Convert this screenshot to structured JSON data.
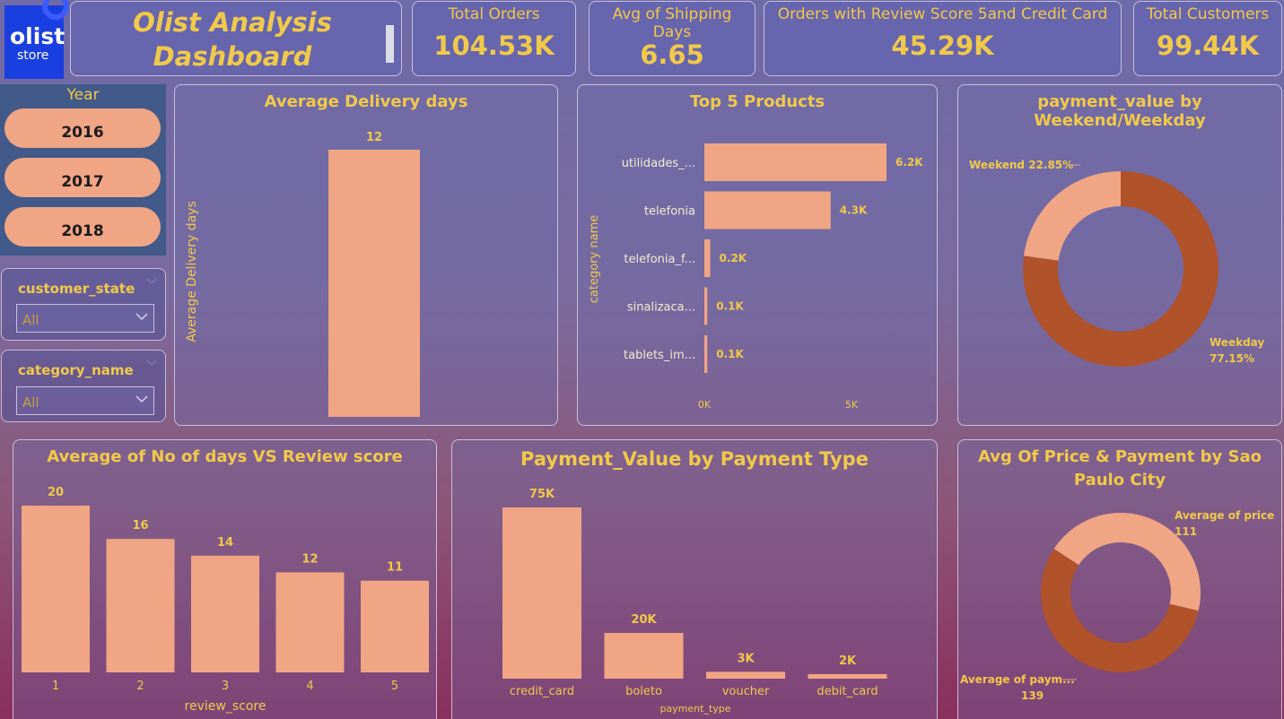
{
  "logo": {
    "line1": "olist",
    "line2": "store"
  },
  "dashboard_title": {
    "line1": "Olist Analysis",
    "line2": "Dashboard"
  },
  "kpis": [
    {
      "label": "Total Orders",
      "value": "104.53K"
    },
    {
      "label": "Avg of Shipping Days",
      "value": "6.65"
    },
    {
      "label": "Orders with Review Score 5and Credit Card",
      "value": "45.29K"
    },
    {
      "label": "Total Customers",
      "value": "99.44K"
    }
  ],
  "year_slicer": {
    "title": "Year",
    "options": [
      "2016",
      "2017",
      "2018"
    ]
  },
  "customer_state": {
    "title": "customer_state",
    "value": "All"
  },
  "category_name": {
    "title": "category_name",
    "value": "All"
  },
  "colors": {
    "bar": "#f0a584",
    "dark": "#b0522a",
    "text": "#f0c94a"
  },
  "chart_data": [
    {
      "type": "bar",
      "title": "Average Delivery days",
      "ylabel": "Average Delivery days",
      "categories": [
        ""
      ],
      "values": [
        12
      ],
      "labels": [
        "12"
      ],
      "ylim": [
        0,
        12
      ]
    },
    {
      "type": "bar",
      "orientation": "horizontal",
      "title": "Top 5 Products",
      "ylabel": "category name",
      "categories": [
        "utilidades_...",
        "telefonia",
        "telefonia_f...",
        "sinalizaca...",
        "tablets_im..."
      ],
      "values": [
        6200,
        4300,
        200,
        100,
        100
      ],
      "labels": [
        "6.2K",
        "4.3K",
        "0.2K",
        "0.1K",
        "0.1K"
      ],
      "xticks": [
        "0K",
        "5K"
      ],
      "xlim": [
        0,
        6200
      ]
    },
    {
      "type": "pie",
      "title": "payment_value by Weekend/Weekday",
      "slices": [
        {
          "name": "Weekend",
          "pct_label": "22.85%",
          "value": 22.85
        },
        {
          "name": "Weekday",
          "pct_label": "77.15%",
          "value": 77.15
        }
      ]
    },
    {
      "type": "bar",
      "title": "Average of No of days VS Review score",
      "xlabel": "review_score",
      "categories": [
        "1",
        "2",
        "3",
        "4",
        "5"
      ],
      "values": [
        20,
        16,
        14,
        12,
        11
      ],
      "labels": [
        "20",
        "16",
        "14",
        "12",
        "11"
      ],
      "ylim": [
        0,
        20
      ]
    },
    {
      "type": "bar",
      "title": "Payment_Value by Payment Type",
      "xlabel": "payment_type",
      "categories": [
        "credit_card",
        "boleto",
        "voucher",
        "debit_card"
      ],
      "values": [
        75,
        20,
        3,
        2
      ],
      "labels": [
        "75K",
        "20K",
        "3K",
        "2K"
      ],
      "ylim": [
        0,
        75
      ]
    },
    {
      "type": "pie",
      "title": "Avg Of Price & Payment by Sao Paulo City",
      "slices": [
        {
          "name": "Average of price",
          "label": "111",
          "value": 111
        },
        {
          "name": "Average of paym...",
          "label": "139",
          "value": 139
        }
      ]
    }
  ]
}
